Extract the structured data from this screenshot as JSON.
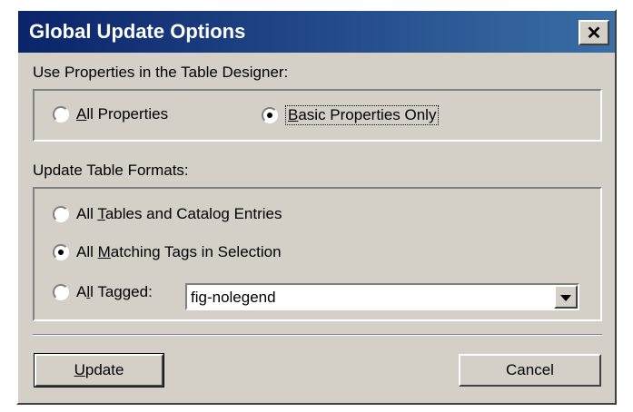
{
  "window": {
    "title": "Global Update Options",
    "close_glyph": "✕"
  },
  "properties_section": {
    "label": "Use Properties in the Table Designer:",
    "options": [
      {
        "label": "All Properties",
        "mnemonic": "A",
        "rest": "ll Properties",
        "selected": false
      },
      {
        "label": "Basic Properties Only",
        "mnemonic": "B",
        "rest": "asic Properties Only",
        "selected": true
      }
    ]
  },
  "formats_section": {
    "label": "Update Table Formats:",
    "options": [
      {
        "label": "All Tables and Catalog Entries",
        "pre": "All ",
        "mnemonic": "T",
        "rest": "ables and Catalog Entries",
        "selected": false
      },
      {
        "label": "All Matching Tags in Selection",
        "pre": "All ",
        "mnemonic": "M",
        "rest": "atching Tags in Selection",
        "selected": true
      },
      {
        "label": "All Tagged:",
        "pre": "A",
        "mnemonic": "l",
        "rest": "l Tagged:",
        "selected": false
      }
    ],
    "tag_select_value": "fig-nolegend"
  },
  "buttons": {
    "update": {
      "mnemonic": "U",
      "rest": "pdate"
    },
    "cancel": "Cancel"
  }
}
